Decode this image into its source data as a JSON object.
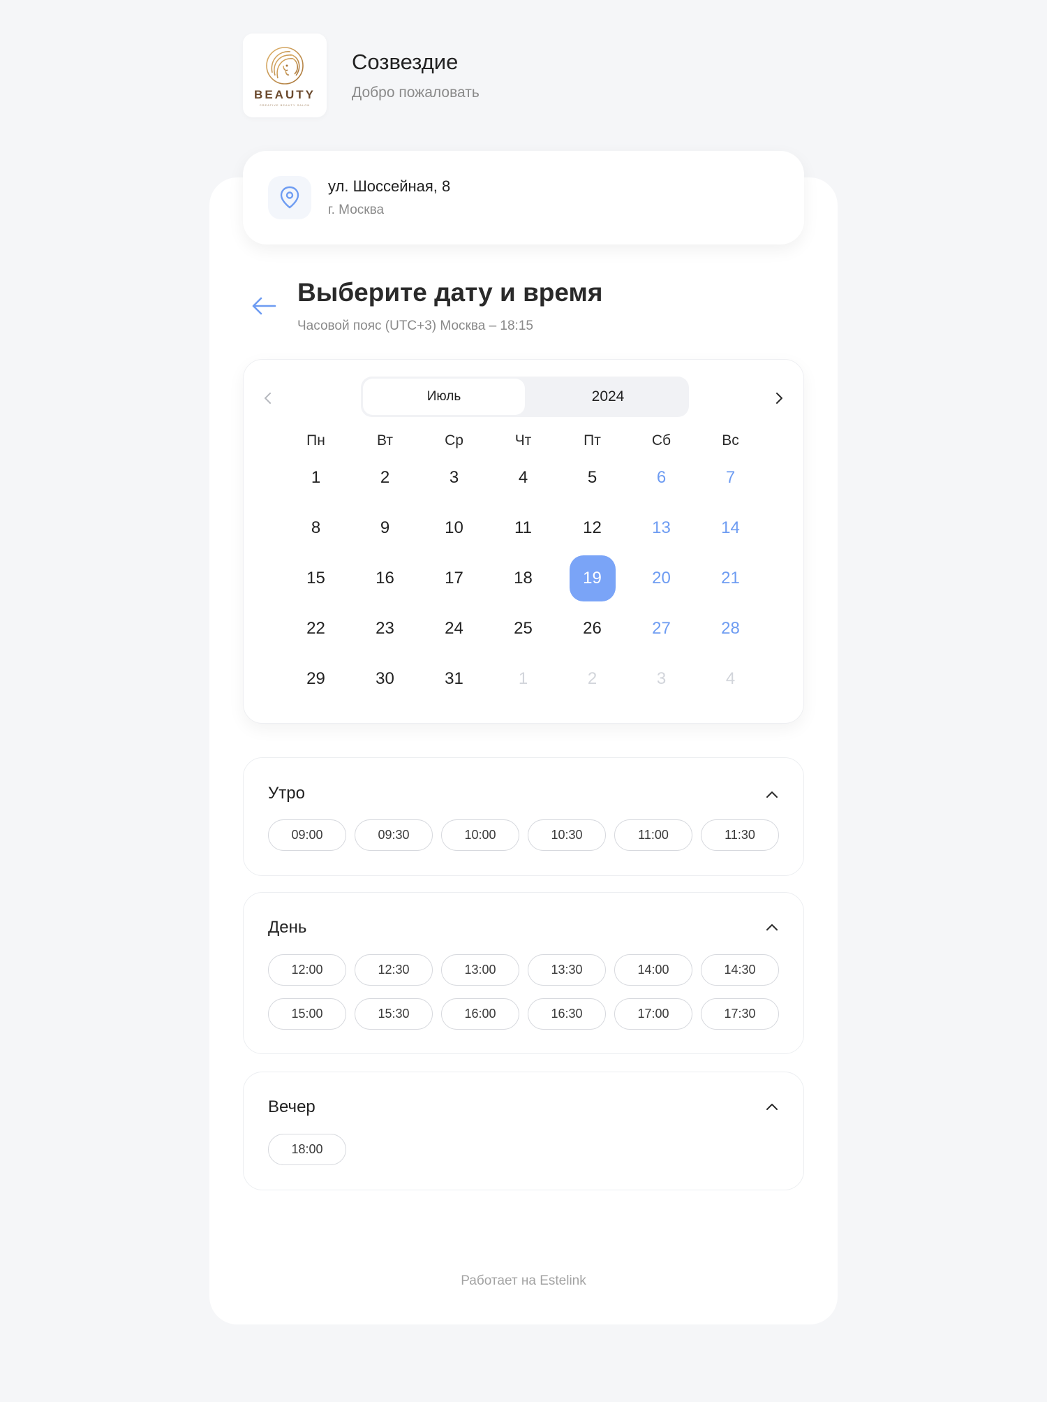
{
  "header": {
    "logo_text": "BEAUTY",
    "logo_subtext": "CREATIVE BEAUTY SALON",
    "title": "Созвездие",
    "subtitle": "Добро пожаловать"
  },
  "address": {
    "icon": "map-pin-icon",
    "street": "ул. Шоссейная, 8",
    "city": "г. Москва"
  },
  "page": {
    "title": "Выберите дату и время",
    "timezone": "Часовой пояс (UTC+3) Москва – 18:15"
  },
  "calendar": {
    "month": "Июль",
    "year": "2024",
    "weekdays": [
      "Пн",
      "Вт",
      "Ср",
      "Чт",
      "Пт",
      "Сб",
      "Вс"
    ],
    "days": [
      "1",
      "2",
      "3",
      "4",
      "5",
      "6",
      "7",
      "8",
      "9",
      "10",
      "11",
      "12",
      "13",
      "14",
      "15",
      "16",
      "17",
      "18",
      "19",
      "20",
      "21",
      "22",
      "23",
      "24",
      "25",
      "26",
      "27",
      "28",
      "29",
      "30",
      "31",
      "1",
      "2",
      "3",
      "4"
    ],
    "selected_day": "19",
    "colors": {
      "weekend": "#6e9cf2",
      "selected": "#7aa4f7",
      "inactive": "#d2d5db"
    }
  },
  "sections": [
    {
      "title": "Утро",
      "slots": [
        "09:00",
        "09:30",
        "10:00",
        "10:30",
        "11:00",
        "11:30"
      ]
    },
    {
      "title": "День",
      "slots": [
        "12:00",
        "12:30",
        "13:00",
        "13:30",
        "14:00",
        "14:30",
        "15:00",
        "15:30",
        "16:00",
        "16:30",
        "17:00",
        "17:30"
      ]
    },
    {
      "title": "Вечер",
      "slots": [
        "18:00"
      ]
    }
  ],
  "footer": {
    "text": "Работает на Estelink"
  }
}
